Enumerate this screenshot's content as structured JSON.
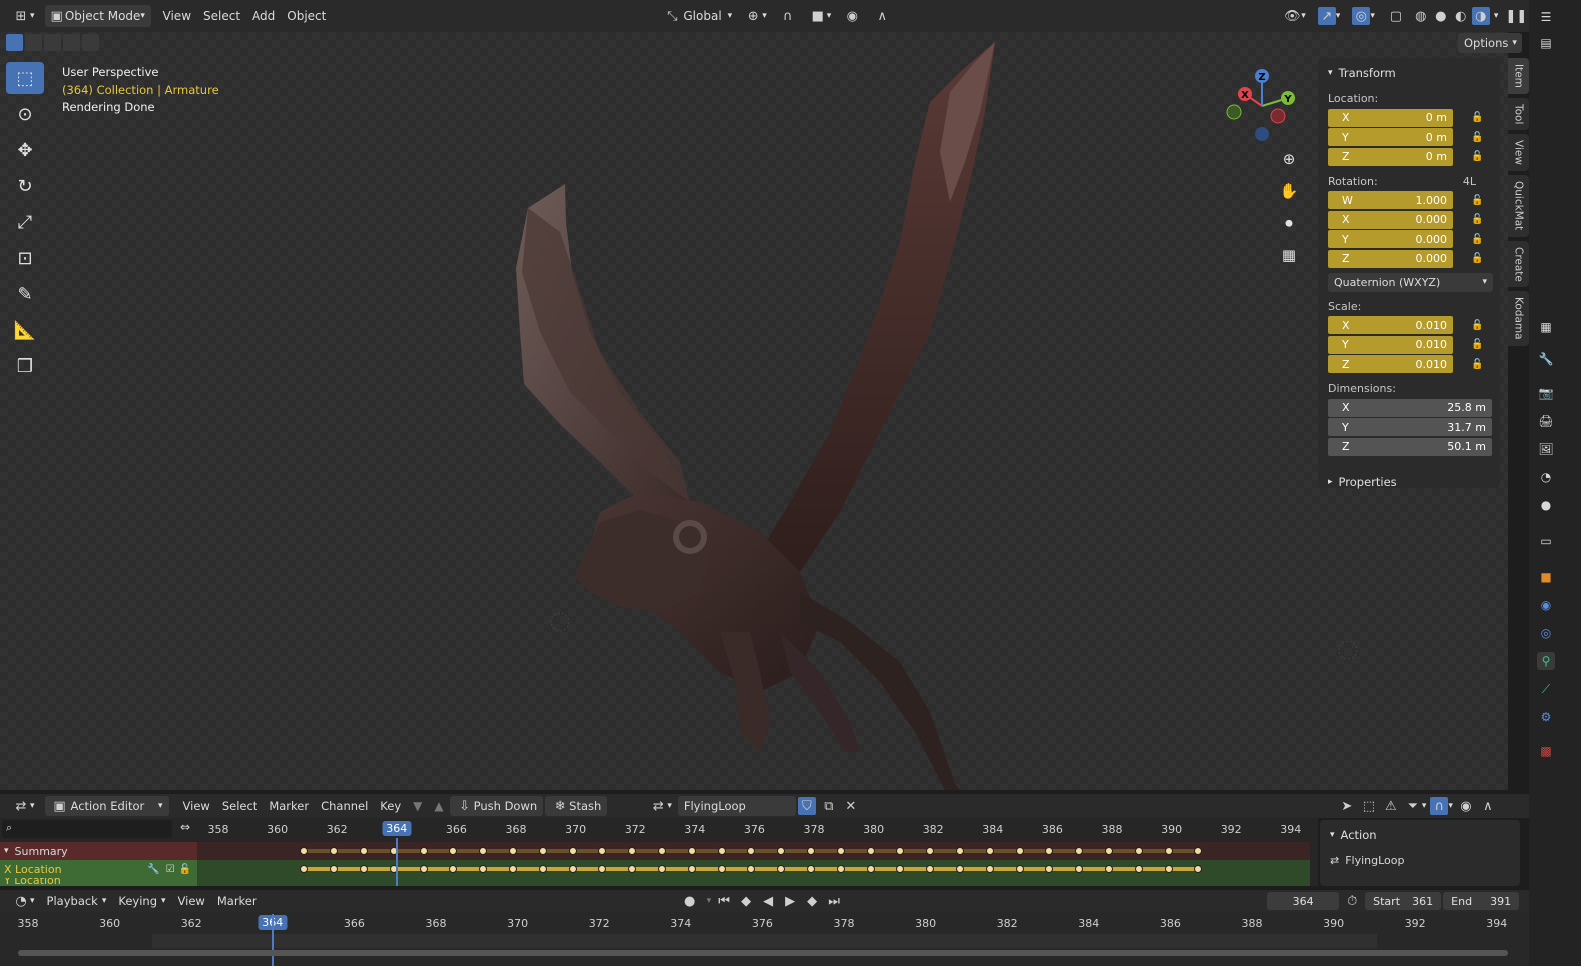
{
  "header": {
    "editor_icon": "view3d-icon",
    "mode": "Object Mode",
    "menus": [
      "View",
      "Select",
      "Add",
      "Object"
    ],
    "transform_orientation": "Global",
    "options_label": "Options"
  },
  "viewport": {
    "overlay": {
      "view_name": "User Perspective",
      "collection_prefix": "(364) Collection |",
      "collection_object": "Armature",
      "status": "Rendering Done"
    },
    "gizmo_axes": [
      "X",
      "Y",
      "Z"
    ]
  },
  "npanel": {
    "transform_title": "Transform",
    "location_label": "Location:",
    "location": [
      {
        "axis": "X",
        "value": "0 m"
      },
      {
        "axis": "Y",
        "value": "0 m"
      },
      {
        "axis": "Z",
        "value": "0 m"
      }
    ],
    "rotation_label": "Rotation:",
    "rotation_extra": "4L",
    "rotation": [
      {
        "axis": "W",
        "value": "1.000"
      },
      {
        "axis": "X",
        "value": "0.000"
      },
      {
        "axis": "Y",
        "value": "0.000"
      },
      {
        "axis": "Z",
        "value": "0.000"
      }
    ],
    "rotation_mode": "Quaternion (WXYZ)",
    "scale_label": "Scale:",
    "scale": [
      {
        "axis": "X",
        "value": "0.010"
      },
      {
        "axis": "Y",
        "value": "0.010"
      },
      {
        "axis": "Z",
        "value": "0.010"
      }
    ],
    "dimensions_label": "Dimensions:",
    "dimensions": [
      {
        "axis": "X",
        "value": "25.8 m"
      },
      {
        "axis": "Y",
        "value": "31.7 m"
      },
      {
        "axis": "Z",
        "value": "50.1 m"
      }
    ],
    "properties_title": "Properties",
    "tabs": [
      "Item",
      "Tool",
      "View",
      "QuickMat",
      "Create",
      "Kodama"
    ]
  },
  "action_editor": {
    "editor_type": "Action Editor",
    "menus": [
      "View",
      "Select",
      "Marker",
      "Channel",
      "Key"
    ],
    "push_down": "Push Down",
    "stash": "Stash",
    "action_name": "FlyingLoop",
    "ruler": [
      "358",
      "360",
      "362",
      "364",
      "366",
      "368",
      "370",
      "372",
      "374",
      "376",
      "378",
      "380",
      "382",
      "384",
      "386",
      "388",
      "390",
      "392",
      "394"
    ],
    "current_frame": "364",
    "channels": [
      {
        "label": "Summary"
      },
      {
        "label": "X Location"
      },
      {
        "label": "Y Location"
      }
    ],
    "panel_title": "Action",
    "panel_action": "FlyingLoop"
  },
  "timeline": {
    "menus": [
      "Playback",
      "Keying",
      "View",
      "Marker"
    ],
    "current_frame": "364",
    "start_label": "Start",
    "start": "361",
    "end_label": "End",
    "end": "391",
    "ruler": [
      "358",
      "360",
      "362",
      "364",
      "366",
      "368",
      "370",
      "372",
      "374",
      "376",
      "378",
      "380",
      "382",
      "384",
      "386",
      "388",
      "390",
      "392",
      "394"
    ]
  },
  "colors": {
    "accent": "#4772b3",
    "keyed_field": "#b59b2b",
    "keyframe": "#f4dca1",
    "summary_row": "#5a2a2a",
    "channel_row": "#3e6b33"
  }
}
